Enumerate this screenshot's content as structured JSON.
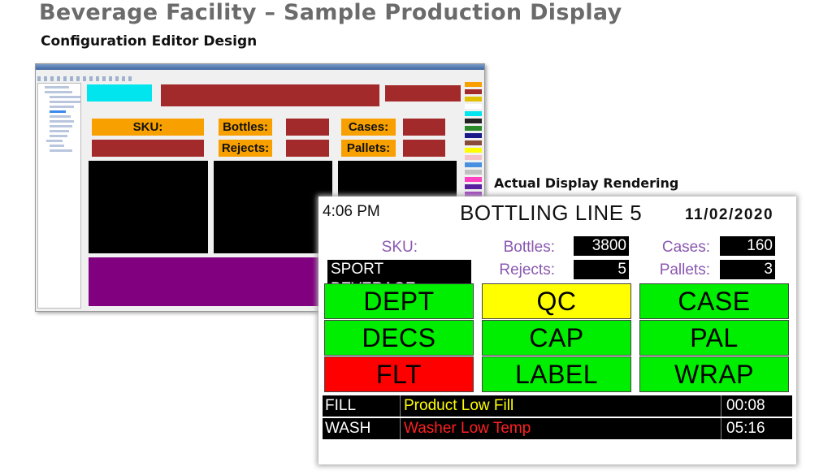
{
  "page": {
    "title": "Beverage Facility – Sample Production Display",
    "subtitle": "Configuration Editor Design",
    "render_label": "Actual Display Rendering"
  },
  "editor": {
    "labels": {
      "sku": "SKU:",
      "bottles": "Bottles:",
      "rejects": "Rejects:",
      "cases": "Cases:",
      "pallets": "Pallets:"
    },
    "colors": {
      "cyan": "#00e5ee",
      "darkred": "#a32a2a",
      "orange": "#f8a000",
      "black": "#000000",
      "purple": "#800080"
    },
    "palette_colors": [
      "#f8a000",
      "#a32a2a",
      "#e0c000",
      "#ffffff",
      "#00e5ee",
      "#222222",
      "#2a8a2a",
      "#1a1a8a",
      "#8a4a3a",
      "#ffff00",
      "#f4c0c8",
      "#4a90e0",
      "#c0c0c0",
      "#ff40c0",
      "#5a20a0",
      "#a040c0"
    ]
  },
  "display": {
    "time": "4:06 PM",
    "line_title": "BOTTLING LINE 5",
    "date": "11/02/2020",
    "sku_label": "SKU:",
    "sku_value": "SPORT BEVERAGE",
    "bottles_label": "Bottles:",
    "bottles_value": "3800",
    "rejects_label": "Rejects:",
    "rejects_value": "5",
    "cases_label": "Cases:",
    "cases_value": "160",
    "pallets_label": "Pallets:",
    "pallets_value": "3",
    "tiles": [
      {
        "label": "DEPT",
        "color": "#00ee00"
      },
      {
        "label": "QC",
        "color": "#ffff00"
      },
      {
        "label": "CASE",
        "color": "#00ee00"
      },
      {
        "label": "DECS",
        "color": "#00ee00"
      },
      {
        "label": "CAP",
        "color": "#00ee00"
      },
      {
        "label": "PAL",
        "color": "#00ee00"
      },
      {
        "label": "FLT",
        "color": "#ff0000"
      },
      {
        "label": "LABEL",
        "color": "#00ee00"
      },
      {
        "label": "WRAP",
        "color": "#00ee00"
      }
    ],
    "alarms": [
      {
        "station": "FILL",
        "message": "Product Low Fill",
        "time": "00:08",
        "color": "#ffff00"
      },
      {
        "station": "WASH",
        "message": "Washer  Low Temp",
        "time": "05:16",
        "color": "#ff2020"
      }
    ]
  }
}
